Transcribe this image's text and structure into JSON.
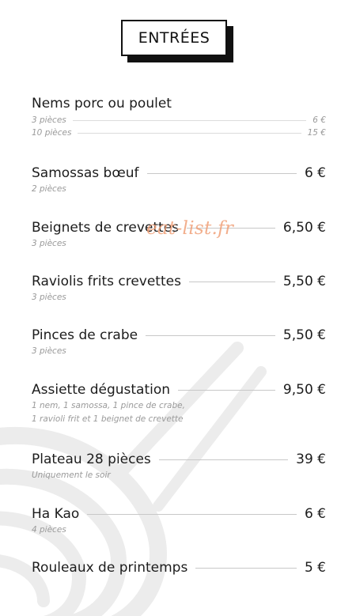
{
  "title": "ENTRÉES",
  "watermark": "eat-list.fr",
  "items": [
    {
      "name": "Nems porc ou poulet",
      "price": "",
      "options": [
        {
          "label": "3 pièces",
          "price": "6 €"
        },
        {
          "label": "10 pièces",
          "price": "15 €"
        }
      ]
    },
    {
      "name": "Samossas bœuf",
      "price": "6 €",
      "desc": [
        "2 pièces"
      ]
    },
    {
      "name": "Beignets de crevettes",
      "price": "6,50 €",
      "desc": [
        "3 pièces"
      ]
    },
    {
      "name": "Raviolis frits crevettes",
      "price": "5,50 €",
      "desc": [
        "3 pièces"
      ]
    },
    {
      "name": "Pinces de crabe",
      "price": "5,50 €",
      "desc": [
        "3 pièces"
      ]
    },
    {
      "name": "Assiette dégustation",
      "price": "9,50 €",
      "desc": [
        "1 nem, 1 samossa, 1 pince de crabe,",
        "1 ravioli frit et 1 beignet de crevette"
      ]
    },
    {
      "name": "Plateau 28 pièces",
      "price": "39 €",
      "desc": [
        "Uniquement le soir"
      ]
    },
    {
      "name": "Ha Kao",
      "price": "6 €",
      "desc": [
        "4 pièces"
      ]
    },
    {
      "name": "Rouleaux de printemps",
      "price": "5 €",
      "desc": []
    }
  ],
  "colors": {
    "background": "#ffffff",
    "text": "#1c1c1c",
    "subtext": "#9a9a9a",
    "decor": "#ececec",
    "watermark": "#f0a078"
  }
}
